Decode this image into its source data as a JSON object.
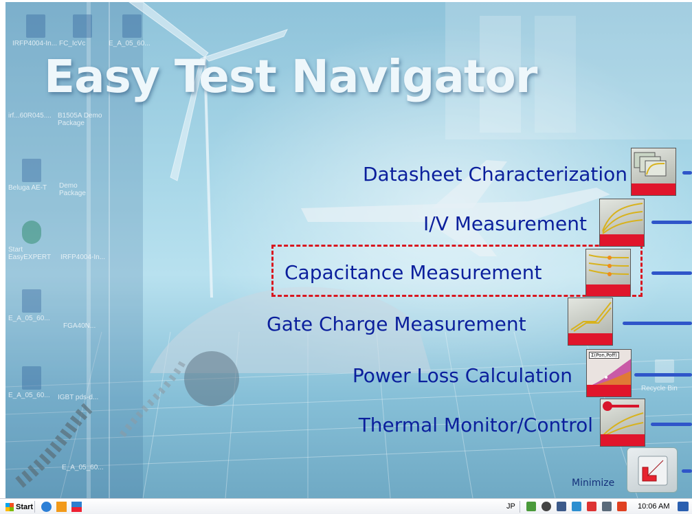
{
  "app": {
    "title": "Easy Test Navigator",
    "minimize_label": "Minimize"
  },
  "desktop_icons": [
    {
      "label": "IRFP4004-In..."
    },
    {
      "label": "FC_IcVc"
    },
    {
      "label": "E_A_05_60..."
    },
    {
      "label": "irf...60R045...."
    },
    {
      "label": "B1505A Demo Package"
    },
    {
      "label": "Beluga AE-T"
    },
    {
      "label": "Demo Package"
    },
    {
      "label": "Start EasyEXPERT"
    },
    {
      "label": "IRFP4004-In..."
    },
    {
      "label": "E_A_05_60..."
    },
    {
      "label": "FGA40N..."
    },
    {
      "label": "E_A_05_60..."
    },
    {
      "label": "IGBT pds-d..."
    },
    {
      "label": "E_A_05_60..."
    },
    {
      "label": "Recycle Bin"
    }
  ],
  "menu": [
    {
      "label": "Datasheet Characterization",
      "thumb_icon": "datasheet-characterization-icon"
    },
    {
      "label": "I/V Measurement",
      "thumb_icon": "iv-measurement-icon"
    },
    {
      "label": "Capacitance Measurement",
      "thumb_icon": "capacitance-measurement-icon",
      "highlighted": true
    },
    {
      "label": "Gate Charge Measurement",
      "thumb_icon": "gate-charge-measurement-icon"
    },
    {
      "label": "Power Loss Calculation",
      "thumb_icon": "power-loss-calculation-icon",
      "thumb_text": "Σ(Pon,Poff)"
    },
    {
      "label": "Thermal Monitor/Control",
      "thumb_icon": "thermal-monitor-control-icon"
    }
  ],
  "taskbar": {
    "start_label": "Start",
    "language": "JP",
    "clock": "10:06 AM"
  },
  "colors": {
    "menu_text": "#0b1f9c",
    "highlight_border": "#d9161f",
    "connector_bar": "#2f55c9",
    "thumb_red": "#e0152b"
  }
}
